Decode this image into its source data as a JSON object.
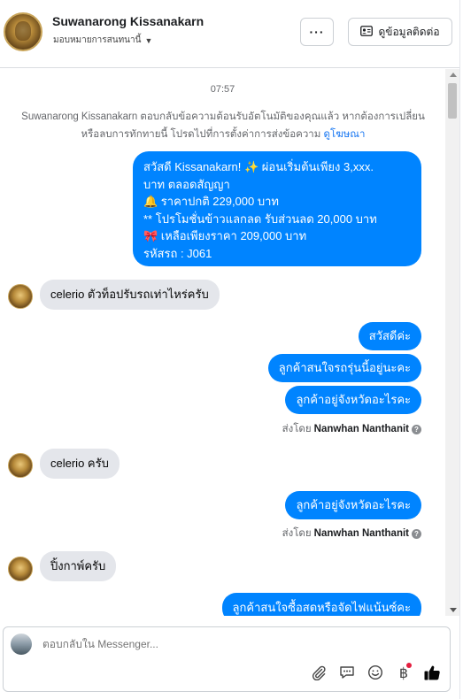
{
  "header": {
    "name": "Suwanarong Kissanakarn",
    "assign": "มอบหมายการสนทนานี้",
    "more_label": "···",
    "contact_label": "ดูข้อมูลติดต่อ"
  },
  "chat": {
    "timestamp": "07:57",
    "notice_text": "Suwanarong Kissanakarn ตอบกลับข้อความต้อนรับอัตโนมัติของคุณแล้ว หากต้องการเปลี่ยนหรือลบการทักทายนี้ โปรดไปที่การตั้งค่าการส่งข้อความ",
    "notice_link": "ดูโฆษณา",
    "promo_lines": [
      "สวัสดี Kissanakarn! ✨  ผ่อนเริ่มต้นเพียง 3,xxx.",
      "บาท ตลอดสัญญา",
      "🔔 ราคาปกติ 229,000 บาท",
      "** โปรโมชั่นข้าวแลกลด รับส่วนลด 20,000 บาท",
      "🎀  เหลือเพียงราคา 209,000 บาท",
      " รหัสรถ : J061"
    ],
    "msg_in_1": "celerio ตัวท็อปรับรถเท่าไหร่ครับ",
    "msg_out_1": "สวัสดีค่ะ",
    "msg_out_2": "ลูกค้าสนใจรถรุ่นนี้อยู่นะคะ",
    "msg_out_3": "ลูกค้าอยู่จังหวัดอะไรคะ",
    "sent_by_prefix": "ส่งโดย",
    "sent_by_name": "Nanwhan Nanthanit",
    "msg_in_2": "celerio ครับ",
    "msg_out_4": "ลูกค้าอยู่จังหวัดอะไรคะ",
    "msg_in_3": "ปิ้งกาพ์ครับ",
    "msg_out_5": "ลูกค้าสนใจซื้อสดหรือจัดไฟแน้นซ์คะ"
  },
  "composer": {
    "placeholder": "ตอบกลับใน Messenger..."
  },
  "colors": {
    "outgoing_bubble": "#0084ff",
    "incoming_bubble": "#e4e6eb",
    "link": "#1877f2",
    "like_icon": "#050505"
  },
  "icons": [
    "chevron-down-icon",
    "contact-card-icon",
    "help-icon",
    "paperclip-icon",
    "saved-reply-icon",
    "emoji-icon",
    "baht-payment-icon",
    "thumbs-up-icon"
  ]
}
